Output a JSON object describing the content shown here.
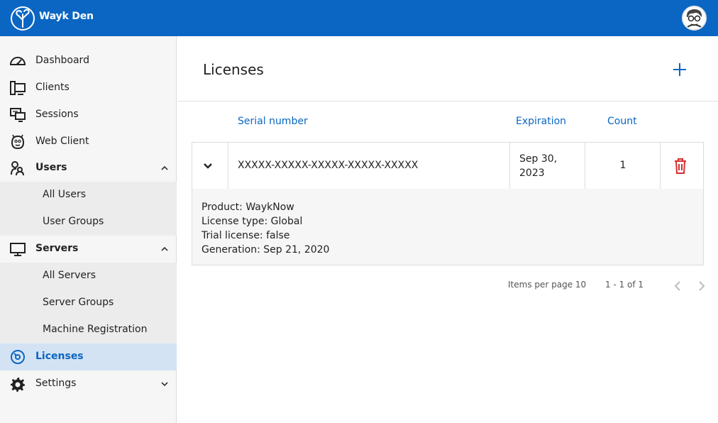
{
  "app": {
    "name": "Wayk Den",
    "logo_icon": "tree-logo-icon",
    "brand_color": "#0a66c2"
  },
  "header": {
    "avatar_icon": "user-avatar"
  },
  "sidebar": {
    "items": [
      {
        "label": "Dashboard",
        "icon": "gauge-icon"
      },
      {
        "label": "Clients",
        "icon": "monitors-icon"
      },
      {
        "label": "Sessions",
        "icon": "screens-icon"
      },
      {
        "label": "Web Client",
        "icon": "mascot-icon"
      },
      {
        "label": "Users",
        "icon": "users-icon",
        "expanded": true,
        "children": [
          {
            "label": "All Users"
          },
          {
            "label": "User Groups"
          }
        ]
      },
      {
        "label": "Servers",
        "icon": "monitor-icon",
        "expanded": true,
        "children": [
          {
            "label": "All Servers"
          },
          {
            "label": "Server Groups"
          },
          {
            "label": "Machine Registration"
          }
        ]
      },
      {
        "label": "Licenses",
        "icon": "license-icon",
        "active": true
      },
      {
        "label": "Settings",
        "icon": "gear-icon",
        "expanded": false
      }
    ]
  },
  "main": {
    "title": "Licenses",
    "table": {
      "headers": {
        "serial": "Serial number",
        "expiration": "Expiration",
        "count": "Count"
      },
      "rows": [
        {
          "serial": "XXXXX-XXXXX-XXXXX-XXXXX-XXXXX",
          "expiration_line1": "Sep 30,",
          "expiration_line2": "2023",
          "count": "1",
          "details": {
            "product": "Product: WaykNow",
            "license_type": "License type: Global",
            "trial": "Trial license: false",
            "generation": "Generation: Sep 21, 2020"
          }
        }
      ]
    },
    "pagination": {
      "items_per_page": "Items per page 10",
      "range": "1 - 1 of 1"
    },
    "delete_color": "#d32f2f"
  }
}
